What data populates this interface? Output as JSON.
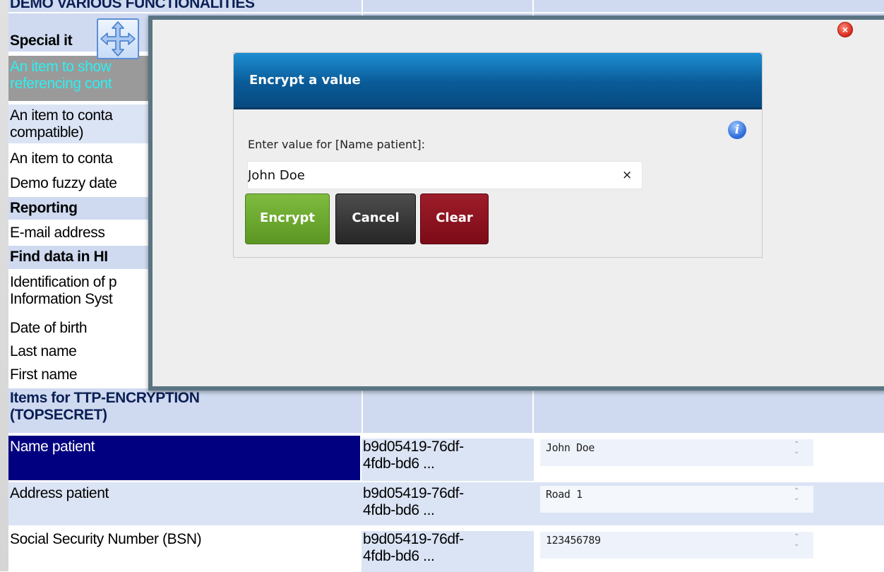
{
  "grid": {
    "header": "DEMO VARIOUS FUNCTIONALITIES",
    "rows": {
      "special_items": "Special it",
      "special_ref_line1": "An item to show",
      "special_ref_line2": "referencing cont",
      "contain1_line1": "An item to conta",
      "contain1_line2": "compatible)",
      "contain2": "An item to conta",
      "fuzzy_date": "Demo fuzzy date",
      "reporting": "Reporting",
      "email": "E-mail address",
      "find_data": "Find data in HI",
      "identification_line1": "Identification of p",
      "identification_line2": "Information Syst",
      "dob": "Date of birth",
      "last_name": "Last name",
      "first_name": "First name",
      "ttp_line1": "Items for TTP-ENCRYPTION",
      "ttp_line2": "(TOPSECRET)"
    },
    "items": [
      {
        "label": "Name patient",
        "hash_line1": "b9d05419-76df-",
        "hash_line2": "4fdb-bd6 ...",
        "value": "John Doe"
      },
      {
        "label": "Address patient",
        "hash_line1": "b9d05419-76df-",
        "hash_line2": "4fdb-bd6 ...",
        "value": "Road 1"
      },
      {
        "label": "Social Security Number (BSN)",
        "hash_line1": "b9d05419-76df-",
        "hash_line2": "4fdb-bd6 ...",
        "value": "123456789"
      }
    ]
  },
  "dialog": {
    "title": "Encrypt a value",
    "prompt": "Enter value for [Name patient]:",
    "input_value": "John Doe",
    "clear_glyph": "×",
    "encrypt_label": "Encrypt",
    "cancel_label": "Cancel",
    "clear_label": "Clear",
    "info_glyph": "i",
    "close_glyph": "×"
  },
  "colors": {
    "selected_row": "#000080",
    "dialog_header": "#0a5b98",
    "encrypt_button": "#6aa52e",
    "cancel_button": "#333333",
    "clear_button": "#8c1220"
  },
  "icons": [
    "move-icon",
    "close-icon",
    "info-icon",
    "clear-icon",
    "spinner-icon"
  ]
}
